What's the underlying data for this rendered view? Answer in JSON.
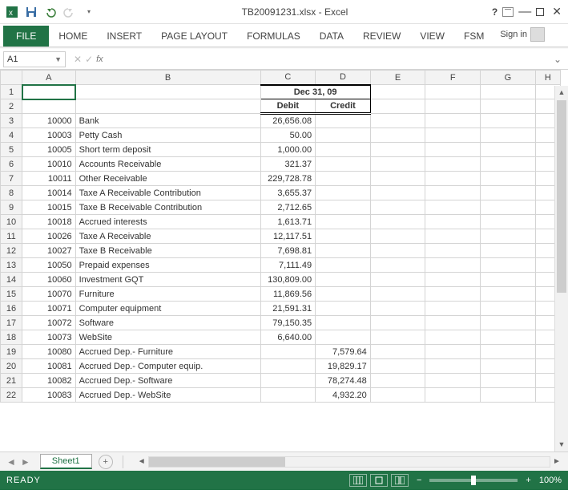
{
  "titlebar": {
    "title_doc": "TB20091231.xlsx",
    "title_app": "Excel"
  },
  "ribbon": {
    "tabs": [
      "FILE",
      "HOME",
      "INSERT",
      "PAGE LAYOUT",
      "FORMULAS",
      "DATA",
      "REVIEW",
      "VIEW",
      "FSM"
    ],
    "signin": "Sign in"
  },
  "namebox": {
    "value": "A1"
  },
  "formula": {
    "fx": "fx",
    "value": ""
  },
  "columns": [
    "A",
    "B",
    "C",
    "D",
    "E",
    "F",
    "G",
    "H"
  ],
  "header": {
    "date_label": "Dec 31, 09",
    "debit": "Debit",
    "credit": "Credit"
  },
  "rows": [
    {
      "n": 3,
      "acct": "10000",
      "name": "Bank",
      "debit": "26,656.08",
      "credit": ""
    },
    {
      "n": 4,
      "acct": "10003",
      "name": "Petty Cash",
      "debit": "50.00",
      "credit": ""
    },
    {
      "n": 5,
      "acct": "10005",
      "name": "Short term deposit",
      "debit": "1,000.00",
      "credit": ""
    },
    {
      "n": 6,
      "acct": "10010",
      "name": "Accounts Receivable",
      "debit": "321.37",
      "credit": ""
    },
    {
      "n": 7,
      "acct": "10011",
      "name": "Other Receivable",
      "debit": "229,728.78",
      "credit": ""
    },
    {
      "n": 8,
      "acct": "10014",
      "name": "Taxe A Receivable Contribution",
      "debit": "3,655.37",
      "credit": ""
    },
    {
      "n": 9,
      "acct": "10015",
      "name": "Taxe B Receivable Contribution",
      "debit": "2,712.65",
      "credit": ""
    },
    {
      "n": 10,
      "acct": "10018",
      "name": "Accrued interests",
      "debit": "1,613.71",
      "credit": ""
    },
    {
      "n": 11,
      "acct": "10026",
      "name": "Taxe A Receivable",
      "debit": "12,117.51",
      "credit": ""
    },
    {
      "n": 12,
      "acct": "10027",
      "name": "Taxe B Receivable",
      "debit": "7,698.81",
      "credit": ""
    },
    {
      "n": 13,
      "acct": "10050",
      "name": "Prepaid expenses",
      "debit": "7,111.49",
      "credit": ""
    },
    {
      "n": 14,
      "acct": "10060",
      "name": "Investment GQT",
      "debit": "130,809.00",
      "credit": ""
    },
    {
      "n": 15,
      "acct": "10070",
      "name": "Furniture",
      "debit": "11,869.56",
      "credit": ""
    },
    {
      "n": 16,
      "acct": "10071",
      "name": "Computer equipment",
      "debit": "21,591.31",
      "credit": ""
    },
    {
      "n": 17,
      "acct": "10072",
      "name": "Software",
      "debit": "79,150.35",
      "credit": ""
    },
    {
      "n": 18,
      "acct": "10073",
      "name": "WebSite",
      "debit": "6,640.00",
      "credit": ""
    },
    {
      "n": 19,
      "acct": "10080",
      "name": "Accrued Dep.- Furniture",
      "debit": "",
      "credit": "7,579.64"
    },
    {
      "n": 20,
      "acct": "10081",
      "name": "Accrued Dep.- Computer equip.",
      "debit": "",
      "credit": "19,829.17"
    },
    {
      "n": 21,
      "acct": "10082",
      "name": "Accrued Dep.- Software",
      "debit": "",
      "credit": "78,274.48"
    },
    {
      "n": 22,
      "acct": "10083",
      "name": "Accrued Dep.- WebSite",
      "debit": "",
      "credit": "4,932.20"
    }
  ],
  "sheet_tabs": {
    "active": "Sheet1"
  },
  "status": {
    "ready": "READY",
    "zoom": "100%"
  }
}
